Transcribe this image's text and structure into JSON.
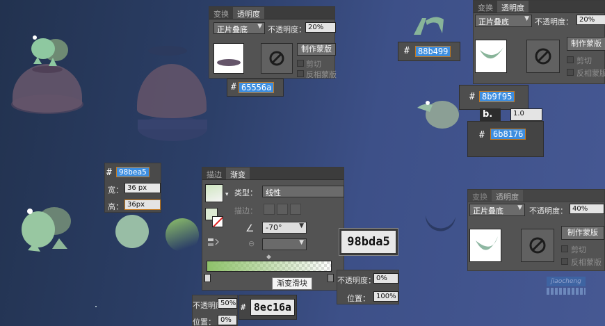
{
  "colors": {
    "background_left": "#22324f",
    "background_right": "#465893",
    "frog_green": "#8ec16a",
    "dome_mauve": "#65556a",
    "highlight_blue": "#3d8ee0",
    "panel_gray": "#535353"
  },
  "transparency_top": {
    "tabs": [
      "变换",
      "透明度"
    ],
    "blend_mode": "正片叠底",
    "opacity_label": "不透明度：",
    "opacity_value": "20%",
    "make_mask": "制作蒙版",
    "clip": "剪切",
    "invert_mask": "反相蒙版"
  },
  "transparency_right": {
    "tabs": [
      "变换",
      "透明度"
    ],
    "blend_mode": "正片叠底",
    "opacity_label": "不透明度：",
    "opacity_value": "20%",
    "make_mask": "制作蒙版",
    "clip": "剪切",
    "invert_mask": "反相蒙版"
  },
  "transparency_bottom": {
    "tabs": [
      "变换",
      "透明度"
    ],
    "blend_mode": "正片叠底",
    "opacity_label": "不透明度：",
    "opacity_value": "40%",
    "make_mask": "制作蒙版",
    "clip": "剪切",
    "invert_mask": "反相蒙版"
  },
  "hex_codes": {
    "hash": "#",
    "dome": "65556a",
    "top_right": "88b499",
    "right_a": "8b9f95",
    "right_b": "6b8176",
    "left": "98bea5",
    "big_a": "98bda5",
    "big_b": "8ec16a"
  },
  "partial_field": "1.0",
  "size_panel": {
    "width_label": "宽：",
    "width_value": "36 px",
    "height_label": "高：",
    "height_value": "36px"
  },
  "gradient_panel": {
    "tabs": [
      "描边",
      "渐变"
    ],
    "type_label": "类型：",
    "type_value": "线性",
    "stroke_label": "描边：",
    "angle_value": "-70°",
    "tooltip": "渐变滑块",
    "opacity_label": "不透明度：",
    "opacity_value": "0%",
    "position_label": "位置：",
    "position_value": "100%"
  },
  "gradient_left_stop": {
    "opacity_label": "不透明度：",
    "opacity_value": "50%",
    "position_label": "位置：",
    "position_value": "0%"
  },
  "watermark": "jiaocheng"
}
